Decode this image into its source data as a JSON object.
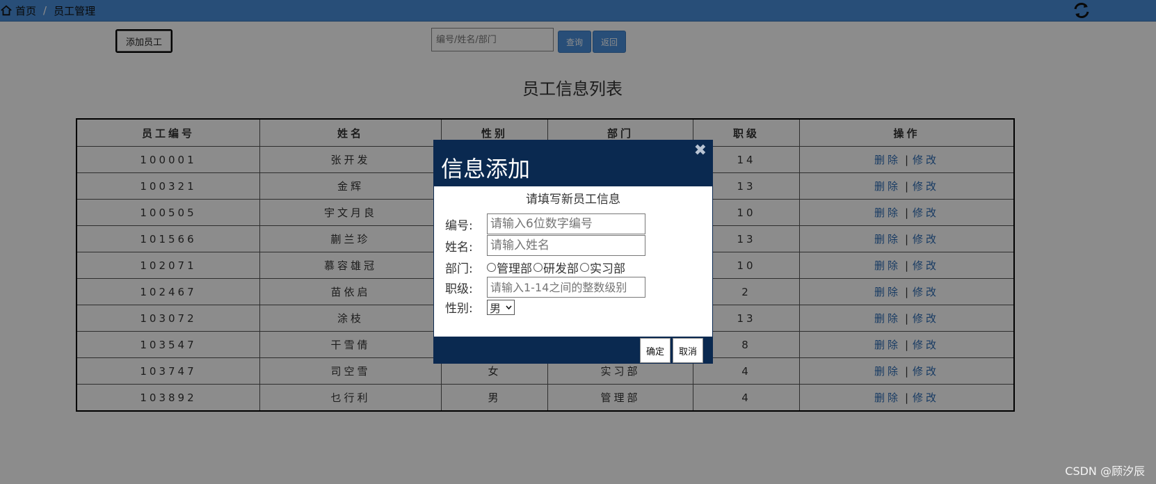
{
  "breadcrumb": {
    "home": "首页",
    "separator": "/",
    "current": "员工管理"
  },
  "toolbar": {
    "add_label": "添加员工",
    "search_placeholder": "编号/姓名/部门",
    "query_label": "查询",
    "back_label": "返回"
  },
  "page": {
    "title": "员工信息列表"
  },
  "table": {
    "headers": [
      "员工编号",
      "姓名",
      "性别",
      "部门",
      "职级",
      "操作"
    ],
    "rows": [
      {
        "id": "100001",
        "name": "张开发",
        "gender": "",
        "dept": "",
        "level": "14"
      },
      {
        "id": "100321",
        "name": "金辉",
        "gender": "",
        "dept": "",
        "level": "13"
      },
      {
        "id": "100505",
        "name": "宇文月良",
        "gender": "",
        "dept": "",
        "level": "10"
      },
      {
        "id": "101566",
        "name": "蒯兰珍",
        "gender": "",
        "dept": "",
        "level": "13"
      },
      {
        "id": "102071",
        "name": "慕容雄冠",
        "gender": "",
        "dept": "",
        "level": "10"
      },
      {
        "id": "102467",
        "name": "苗依启",
        "gender": "",
        "dept": "",
        "level": "2"
      },
      {
        "id": "103072",
        "name": "涂枝",
        "gender": "",
        "dept": "",
        "level": "13"
      },
      {
        "id": "103547",
        "name": "干雪倩",
        "gender": "",
        "dept": "",
        "level": "8"
      },
      {
        "id": "103747",
        "name": "司空雪",
        "gender": "女",
        "dept": "实习部",
        "level": "4"
      },
      {
        "id": "103892",
        "name": "乜行利",
        "gender": "男",
        "dept": "管理部",
        "level": "4"
      }
    ],
    "delete_label": "删除",
    "edit_label": "修改",
    "op_separator": "|"
  },
  "modal": {
    "title": "信息添加",
    "close": "✖",
    "subtitle": "请填写新员工信息",
    "id_label": "编号:",
    "id_placeholder": "请输入6位数字编号",
    "name_label": "姓名:",
    "name_placeholder": "请输入姓名",
    "dept_label": "部门:",
    "dept_options": [
      "管理部",
      "研发部",
      "实习部"
    ],
    "level_label": "职级:",
    "level_placeholder": "请输入1-14之间的整数级别",
    "gender_label": "性别:",
    "gender_value": "男",
    "ok_label": "确定",
    "cancel_label": "取消"
  },
  "watermark": "CSDN @顾汐辰"
}
